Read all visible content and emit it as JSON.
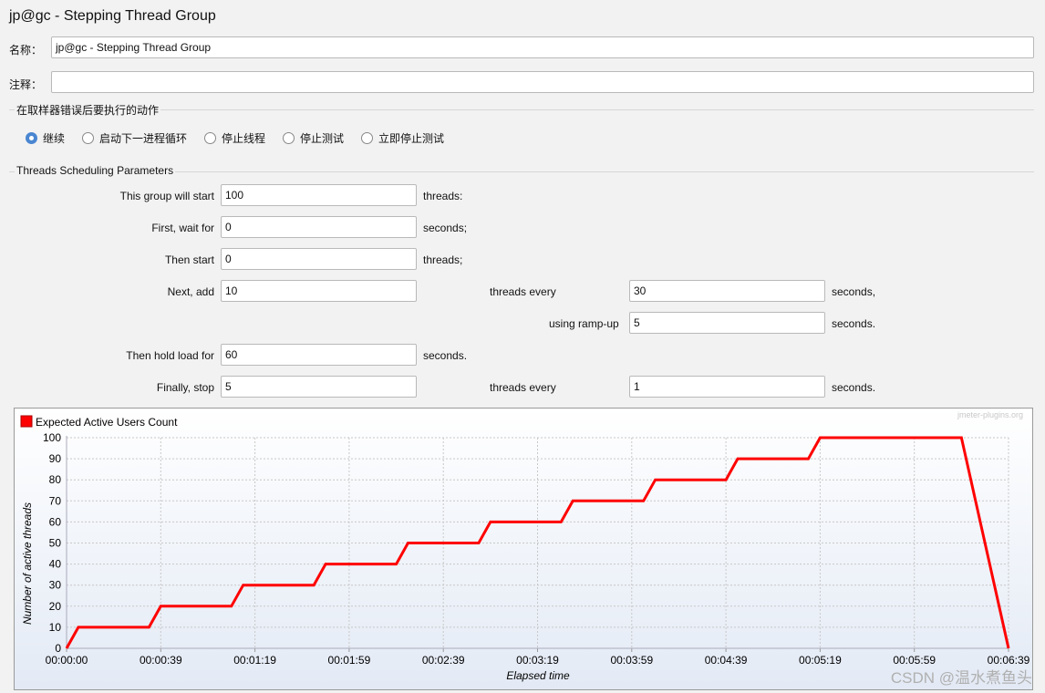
{
  "window_title": "jp@gc - Stepping Thread Group",
  "name_label": "名称：",
  "name_value": "jp@gc - Stepping Thread Group",
  "comment_label": "注释：",
  "comment_value": "",
  "error_section": {
    "title": "在取样器错误后要执行的动作",
    "options": [
      {
        "label": "继续",
        "selected": true
      },
      {
        "label": "启动下一进程循环",
        "selected": false
      },
      {
        "label": "停止线程",
        "selected": false
      },
      {
        "label": "停止测试",
        "selected": false
      },
      {
        "label": "立即停止测试",
        "selected": false
      }
    ]
  },
  "sched": {
    "title": "Threads Scheduling Parameters",
    "start_label": "This group will start",
    "start_value": "100",
    "start_unit": "threads:",
    "wait_label": "First, wait for",
    "wait_value": "0",
    "wait_unit": "seconds;",
    "then_label": "Then start",
    "then_value": "0",
    "then_unit": "threads;",
    "next_label": "Next, add",
    "next_value": "10",
    "next_mid": "threads every",
    "next_every": "30",
    "next_unit": "seconds,",
    "ramp_label": "using ramp-up",
    "ramp_value": "5",
    "ramp_unit": "seconds.",
    "hold_label": "Then hold load for",
    "hold_value": "60",
    "hold_unit": "seconds.",
    "stop_label": "Finally, stop",
    "stop_value": "5",
    "stop_mid": "threads every",
    "stop_every": "1",
    "stop_unit": "seconds."
  },
  "watermark": "jmeter-plugins.org",
  "csdn_watermark": "CSDN @温水煮鱼头",
  "chart_data": {
    "type": "line",
    "title": "",
    "xlabel": "Elapsed time",
    "ylabel": "Number of active threads",
    "xlim": [
      0,
      400
    ],
    "ylim": [
      0,
      100
    ],
    "grid": true,
    "legend_placement": "top-left",
    "xticks": [
      0,
      40,
      80,
      120,
      160,
      200,
      240,
      280,
      320,
      360,
      400
    ],
    "xtick_labels": [
      "00:00:00",
      "00:00:39",
      "00:01:19",
      "00:01:59",
      "00:02:39",
      "00:03:19",
      "00:03:59",
      "00:04:39",
      "00:05:19",
      "00:05:59",
      "00:06:39"
    ],
    "yticks": [
      0,
      10,
      20,
      30,
      40,
      50,
      60,
      70,
      80,
      90,
      100
    ],
    "series": [
      {
        "name": "Expected Active Users Count",
        "color": "#ff0000",
        "points": [
          [
            0,
            0
          ],
          [
            5,
            10
          ],
          [
            35,
            10
          ],
          [
            40,
            20
          ],
          [
            70,
            20
          ],
          [
            75,
            30
          ],
          [
            105,
            30
          ],
          [
            110,
            40
          ],
          [
            140,
            40
          ],
          [
            145,
            50
          ],
          [
            175,
            50
          ],
          [
            180,
            60
          ],
          [
            210,
            60
          ],
          [
            215,
            70
          ],
          [
            245,
            70
          ],
          [
            250,
            80
          ],
          [
            280,
            80
          ],
          [
            285,
            90
          ],
          [
            315,
            90
          ],
          [
            320,
            100
          ],
          [
            380,
            100
          ],
          [
            381,
            95
          ],
          [
            382,
            90
          ],
          [
            383,
            85
          ],
          [
            384,
            80
          ],
          [
            385,
            75
          ],
          [
            386,
            70
          ],
          [
            387,
            65
          ],
          [
            388,
            60
          ],
          [
            389,
            55
          ],
          [
            390,
            50
          ],
          [
            391,
            45
          ],
          [
            392,
            40
          ],
          [
            393,
            35
          ],
          [
            394,
            30
          ],
          [
            395,
            25
          ],
          [
            396,
            20
          ],
          [
            397,
            15
          ],
          [
            398,
            10
          ],
          [
            399,
            5
          ],
          [
            400,
            0
          ]
        ]
      }
    ]
  }
}
